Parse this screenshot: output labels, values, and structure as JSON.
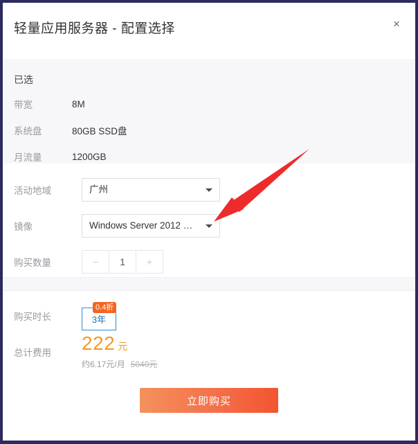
{
  "dialog": {
    "title": "轻量应用服务器 - 配置选择",
    "close_label": "×",
    "close_icon": "close-icon"
  },
  "selected": {
    "heading": "已选",
    "items": [
      {
        "label": "带宽",
        "value": "8M"
      },
      {
        "label": "系统盘",
        "value": "80GB SSD盘"
      },
      {
        "label": "月流量",
        "value": "1200GB"
      }
    ]
  },
  "config": {
    "region": {
      "label": "活动地域",
      "value": "广州",
      "caret_icon": "chevron-down-icon"
    },
    "image": {
      "label": "镜像",
      "value": "Windows Server 2012 …",
      "caret_icon": "chevron-down-icon"
    },
    "quantity": {
      "label": "购买数量",
      "minus_label": "−",
      "value": "1",
      "plus_label": "+"
    }
  },
  "pricing": {
    "duration": {
      "label": "购买时长",
      "option": "3年",
      "discount_badge": "0.4折"
    },
    "total": {
      "label": "总计费用",
      "amount": "222",
      "unit": "元",
      "monthly": "约6.17元/月",
      "original": "5040元"
    }
  },
  "actions": {
    "buy_label": "立即购买"
  },
  "colors": {
    "accent_orange": "#f59a23",
    "badge_orange": "#f26522",
    "button_start": "#f4915c",
    "button_end": "#f2552f",
    "select_blue": "#2a8fd6",
    "annotation_red": "#ee2b2b"
  }
}
